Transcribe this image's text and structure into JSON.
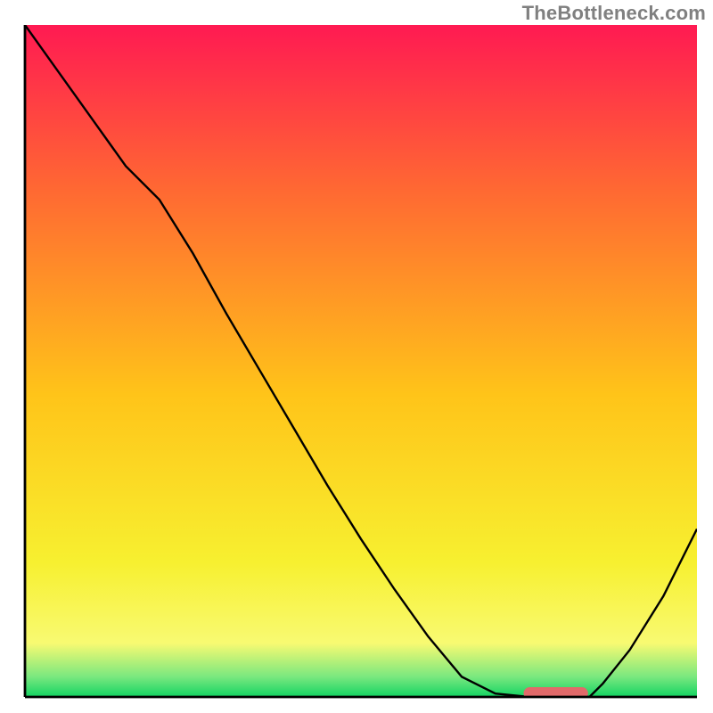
{
  "watermark": "TheBottleneck.com",
  "chart_data": {
    "type": "line",
    "title": "",
    "xlabel": "",
    "ylabel": "",
    "x": [
      0,
      5,
      10,
      15,
      20,
      25,
      30,
      35,
      40,
      45,
      50,
      55,
      60,
      65,
      70,
      75,
      80,
      82,
      84,
      86,
      90,
      95,
      100
    ],
    "values": [
      100,
      93,
      86,
      79,
      74,
      66,
      57,
      48.5,
      40,
      31.5,
      23.5,
      16,
      9,
      3,
      0.5,
      0,
      0,
      0,
      0,
      2,
      7,
      15,
      25
    ],
    "ylim": [
      0,
      100
    ],
    "xlim": [
      0,
      100
    ],
    "optimum_range_x": [
      75,
      83
    ],
    "background_gradient": {
      "top": "#ff1a52",
      "stops": [
        {
          "pos": 0.0,
          "color": "#ff1a52"
        },
        {
          "pos": 0.25,
          "color": "#ff6a32"
        },
        {
          "pos": 0.55,
          "color": "#ffc419"
        },
        {
          "pos": 0.8,
          "color": "#f7f030"
        },
        {
          "pos": 0.92,
          "color": "#f8fa72"
        },
        {
          "pos": 0.97,
          "color": "#7ae87f"
        },
        {
          "pos": 1.0,
          "color": "#13d463"
        }
      ]
    },
    "marker": {
      "x": 79,
      "y": 0,
      "color": "#e16a6a"
    },
    "axes_color": "#000000",
    "grid": false
  }
}
